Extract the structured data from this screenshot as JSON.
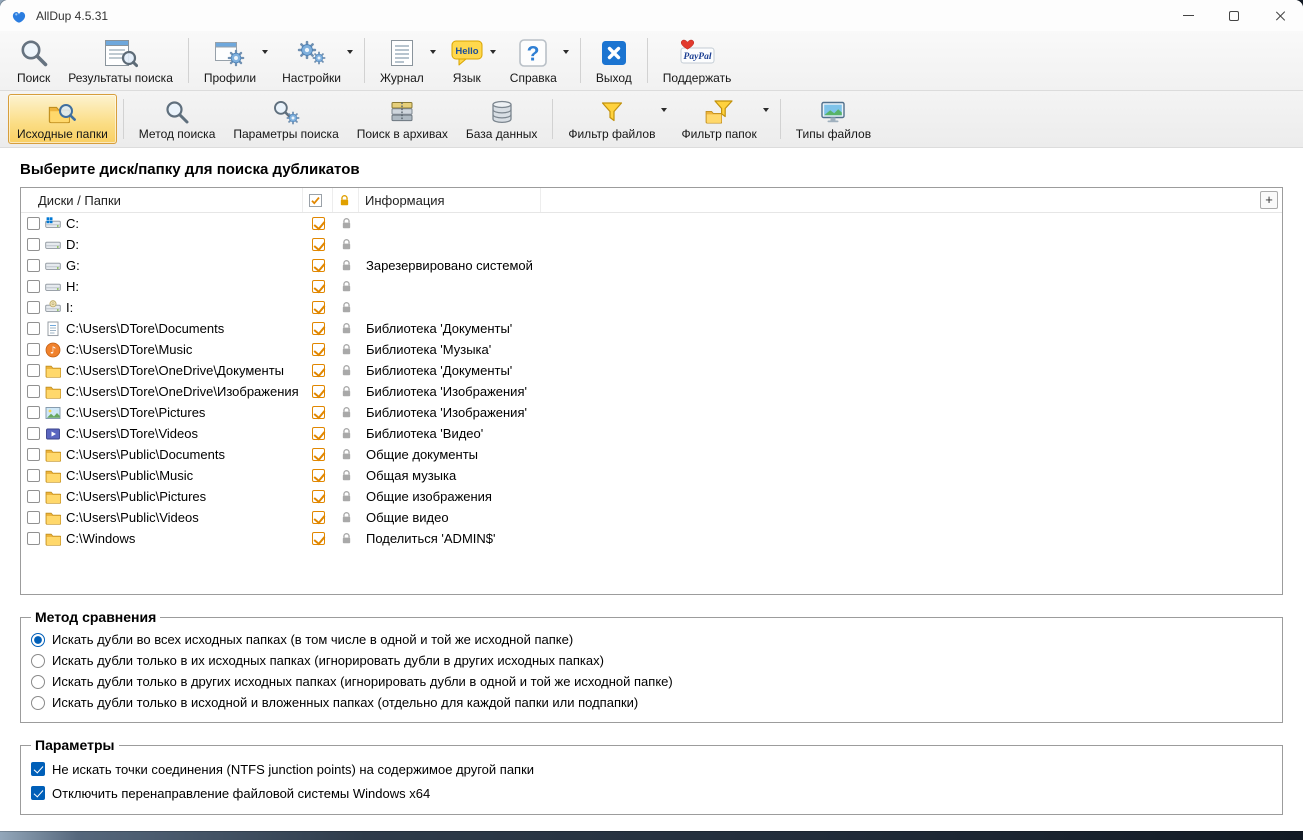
{
  "window": {
    "title": "AllDup 4.5.31"
  },
  "colors": {
    "accent_blue": "#005fb8",
    "check_orange": "#e18700",
    "active_tab_bg": "#fbdd84"
  },
  "icons": {
    "app": "alldup-blue-swirl",
    "search": "magnifier",
    "results": "window-with-magnifier",
    "profiles": "window-with-gear",
    "settings": "two-gears",
    "journal": "lined-page",
    "language": "hello-speech-bubble",
    "help": "question-mark",
    "exit": "blue-x",
    "donate": "paypal-heart",
    "source_folders": "folder-with-magnifier",
    "search_method": "magnifier",
    "search_options": "magnifier-gear",
    "archives": "archive-stack",
    "database": "cylinder",
    "file_filter": "funnel",
    "folder_filter": "funnel-folder",
    "file_types": "monitor",
    "subfolder_column": "checkbox",
    "protect_column": "lock"
  },
  "toolbar_main": {
    "items": [
      {
        "label": "Поиск",
        "icon": "search",
        "dropdown": false
      },
      {
        "label": "Результаты поиска",
        "icon": "results",
        "dropdown": false
      },
      {
        "label": "Профили",
        "icon": "profiles",
        "dropdown": true
      },
      {
        "label": "Настройки",
        "icon": "settings",
        "dropdown": true
      },
      {
        "label": "Журнал",
        "icon": "journal",
        "dropdown": true
      },
      {
        "label": "Язык",
        "icon": "language",
        "dropdown": true
      },
      {
        "label": "Справка",
        "icon": "help",
        "dropdown": true
      },
      {
        "label": "Выход",
        "icon": "exit",
        "dropdown": false
      },
      {
        "label": "Поддержать",
        "icon": "donate",
        "dropdown": false
      }
    ]
  },
  "toolbar_search": {
    "items": [
      {
        "label": "Исходные папки",
        "icon": "source_folders",
        "active": true,
        "dropdown": false
      },
      {
        "label": "Метод поиска",
        "icon": "search_method",
        "active": false,
        "dropdown": false
      },
      {
        "label": "Параметры поиска",
        "icon": "search_options",
        "active": false,
        "dropdown": false
      },
      {
        "label": "Поиск в архивах",
        "icon": "archives",
        "active": false,
        "dropdown": false
      },
      {
        "label": "База данных",
        "icon": "database",
        "active": false,
        "dropdown": false
      },
      {
        "label": "Фильтр файлов",
        "icon": "file_filter",
        "active": false,
        "dropdown": true
      },
      {
        "label": "Фильтр папок",
        "icon": "folder_filter",
        "active": false,
        "dropdown": true
      },
      {
        "label": "Типы файлов",
        "icon": "file_types",
        "active": false,
        "dropdown": false
      }
    ]
  },
  "main": {
    "heading": "Выберите диск/папку для поиска дубликатов",
    "table": {
      "columns": [
        "Диски / Папки",
        "Информация"
      ],
      "add_button": "+",
      "rows": [
        {
          "path": "C:",
          "icon": "system-drive",
          "info": "",
          "checked": false,
          "recursive": true
        },
        {
          "path": "D:",
          "icon": "drive",
          "info": "",
          "checked": false,
          "recursive": true
        },
        {
          "path": "G:",
          "icon": "drive",
          "info": "Зарезервировано системой",
          "checked": false,
          "recursive": true
        },
        {
          "path": "H:",
          "icon": "drive",
          "info": "",
          "checked": false,
          "recursive": true
        },
        {
          "path": "I:",
          "icon": "cd-drive",
          "info": "",
          "checked": false,
          "recursive": true
        },
        {
          "path": "C:\\Users\\DTore\\Documents",
          "icon": "documents",
          "info": "Библиотека 'Документы'",
          "checked": false,
          "recursive": true
        },
        {
          "path": "C:\\Users\\DTore\\Music",
          "icon": "music",
          "info": "Библиотека 'Музыка'",
          "checked": false,
          "recursive": true
        },
        {
          "path": "C:\\Users\\DTore\\OneDrive\\Документы",
          "icon": "folder",
          "info": "Библиотека 'Документы'",
          "checked": false,
          "recursive": true
        },
        {
          "path": "C:\\Users\\DTore\\OneDrive\\Изображения",
          "icon": "folder",
          "info": "Библиотека 'Изображения'",
          "checked": false,
          "recursive": true
        },
        {
          "path": "C:\\Users\\DTore\\Pictures",
          "icon": "pictures",
          "info": "Библиотека 'Изображения'",
          "checked": false,
          "recursive": true
        },
        {
          "path": "C:\\Users\\DTore\\Videos",
          "icon": "videos",
          "info": "Библиотека 'Видео'",
          "checked": false,
          "recursive": true
        },
        {
          "path": "C:\\Users\\Public\\Documents",
          "icon": "folder",
          "info": "Общие документы",
          "checked": false,
          "recursive": true
        },
        {
          "path": "C:\\Users\\Public\\Music",
          "icon": "folder",
          "info": "Общая музыка",
          "checked": false,
          "recursive": true
        },
        {
          "path": "C:\\Users\\Public\\Pictures",
          "icon": "folder",
          "info": "Общие изображения",
          "checked": false,
          "recursive": true
        },
        {
          "path": "C:\\Users\\Public\\Videos",
          "icon": "folder",
          "info": "Общие видео",
          "checked": false,
          "recursive": true
        },
        {
          "path": "C:\\Windows",
          "icon": "folder",
          "info": "Поделиться 'ADMIN$'",
          "checked": false,
          "recursive": true
        }
      ]
    },
    "comparison_method": {
      "title": "Метод сравнения",
      "options": [
        {
          "label": "Искать дубли во всех исходных папках (в том числе в одной и той же исходной папке)",
          "selected": true
        },
        {
          "label": "Искать дубли только в их исходных папках (игнорировать дубли в других исходных папках)",
          "selected": false
        },
        {
          "label": "Искать дубли только в других исходных папках (игнорировать дубли в одной и той же исходной папке)",
          "selected": false
        },
        {
          "label": "Искать дубли только в исходной и вложенных папках (отдельно для каждой папки или подпапки)",
          "selected": false
        }
      ]
    },
    "parameters": {
      "title": "Параметры",
      "options": [
        {
          "label": "Не искать точки соединения (NTFS junction points) на содержимое другой папки",
          "checked": true
        },
        {
          "label": "Отключить перенаправление файловой системы Windows x64",
          "checked": true
        }
      ]
    }
  }
}
